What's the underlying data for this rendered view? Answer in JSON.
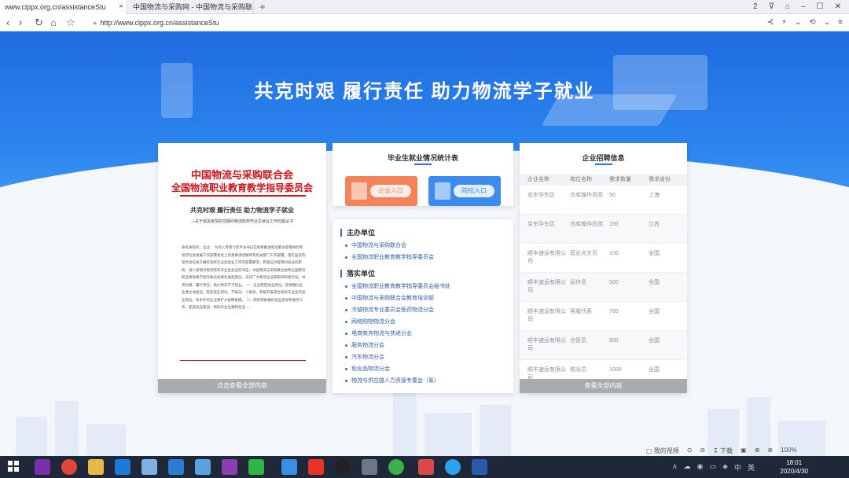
{
  "browser": {
    "tabs": [
      {
        "label": "www.clppx.org.cn/assistanceStu",
        "close": "×"
      },
      {
        "label": "中国物流与采购网 - 中国物流与采购联",
        "close": ""
      }
    ],
    "new_tab": "+",
    "window_controls": [
      "2",
      "⊽",
      "⌂",
      "–",
      "☐",
      "✕"
    ],
    "nav": {
      "back": "‹",
      "forward": "›",
      "reload": "↻",
      "home": "⌂",
      "star": "☆"
    },
    "url": "http://www.clppx.org.cn/assistanceStu",
    "right_controls": [
      "⊰",
      "⚡",
      "⌄",
      "⟲",
      "⌄",
      "≡"
    ]
  },
  "banner": {
    "title": "共克时艰 履行责任 助力物流学子就业",
    "bg_color": "#2a7be8"
  },
  "doc_card": {
    "title1": "中国物流与采购联合会",
    "title2": "全国物流职业教育教学指导委员会",
    "subtitle": "共克时艰 履行责任 助力物流学子就业",
    "subtitle2": "—关于促进疫情防控期间物流院校毕业生就业工作的倡议书",
    "body": "各有关院校、企业：  为深入贯彻习近平总书记在统筹推进新冠肺炎疫情防控和经济社会发展工作部署会议上的重要讲话精神及有关部门工作部署，落实国务院常务会议关于做好高校毕业生就业工作的部署要求，积极应对疫情对就业的影响，减少疫情对物流院校毕业生就业的冲击，中国物流与采购联合会和全国物流职业教育教学指导委员会联合发起倡议，号召广大物流企业和院校积极行动，共克时艰、履行责任、助力物流学子就业。  一、企业稳定就业岗位。疫情期间企业要主动担当，稳定就业岗位，不裁员、少裁员，积极开发适合高校毕业生的就业岗位，有条件的企业要扩大招聘规模。  二、院校积极做好就业指导和服务工作，拓宽就业渠道，帮助毕业生顺利就业……",
    "footer": "点击查看全部内容"
  },
  "stats_card": {
    "title": "毕业生就业情况统计表",
    "enterprise_btn": "企业入口",
    "school_btn": "院校入口"
  },
  "orgs": {
    "host_heading": "主办单位",
    "hosts": [
      "中国物流与采购联合会",
      "全国物流职业教育教学指导委员会"
    ],
    "impl_heading": "落实单位",
    "impl": [
      "全国物流职业教育教学指导委员会秘书处",
      "中国物流与采购联合会教育培训部",
      "冷链物流专业委员会医药物流分会",
      "网络购物物流分会",
      "电商商务物流与快递分会",
      "服务物流分会",
      "汽车物流分会",
      "危化品物流分会",
      "物流与供应链人力资源专委会（筹）"
    ]
  },
  "jobs": {
    "title": "企业招聘信息",
    "headers": [
      "企业名称",
      "岗位名称",
      "需求数量",
      "需求省份"
    ],
    "rows": [
      [
        "京东华东区",
        "仓库操作员岗",
        "50",
        "上海"
      ],
      [
        "京东华东区",
        "仓库操作员岗",
        "150",
        "江苏"
      ],
      [
        "顺丰速运有限公司",
        "营业点文员",
        "100",
        "全国"
      ],
      [
        "顺丰速运有限公司",
        "运作员",
        "500",
        "全国"
      ],
      [
        "顺丰速运有限公司",
        "客服代表",
        "700",
        "全国"
      ],
      [
        "顺丰速运有限公司",
        "仓管员",
        "500",
        "全国"
      ],
      [
        "顺丰速运有限公司",
        "收派员",
        "1000",
        "全国"
      ]
    ],
    "footer": "查看全部内容"
  },
  "statusbar": [
    "▢ 我的视频",
    "⊙",
    "⊘",
    "↧ 下载",
    "▣",
    "⊕",
    "⊗",
    "100%"
  ],
  "taskbar": {
    "time": "18:01",
    "date": "2020/4/30",
    "lang": "英",
    "tray": [
      "∧",
      "☁",
      "◉",
      "▭",
      "◈",
      "中"
    ]
  }
}
